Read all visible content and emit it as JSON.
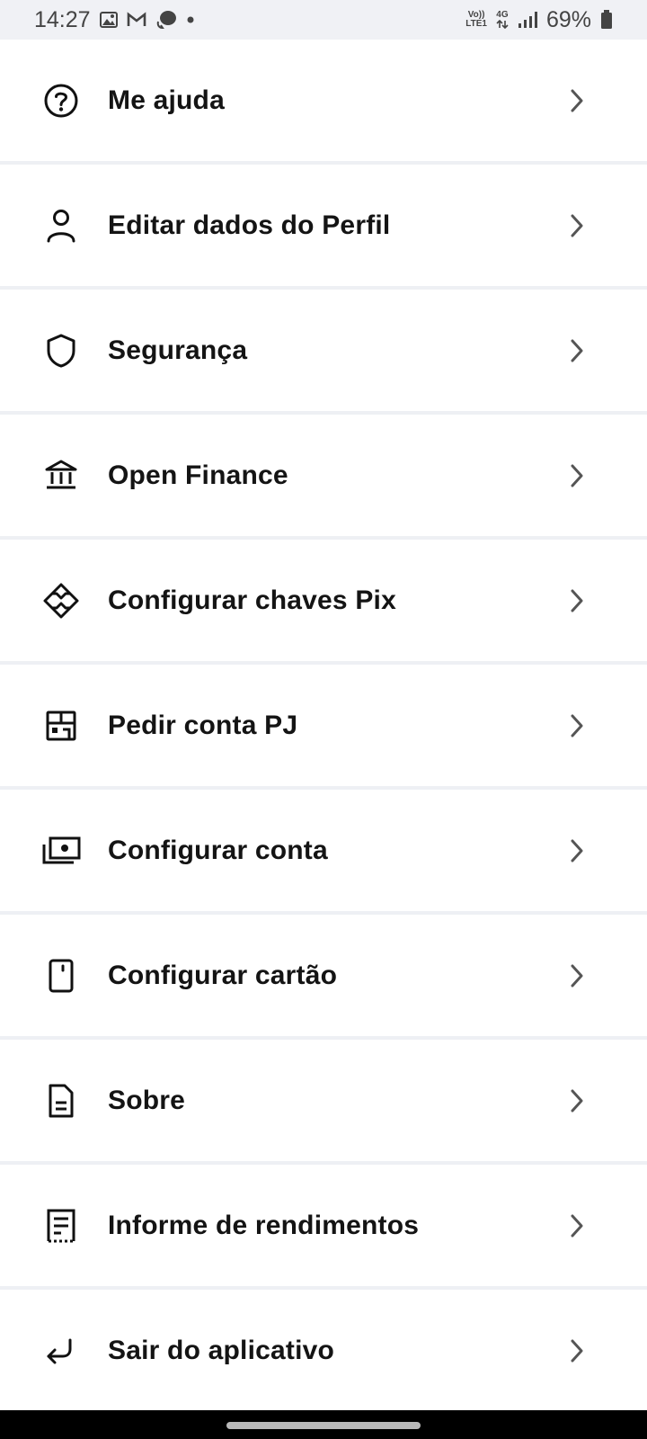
{
  "status_bar": {
    "time": "14:27",
    "network_top": "Vo))",
    "network_bottom": "LTE1",
    "data_type": "4G",
    "battery": "69%"
  },
  "menu": {
    "items": [
      {
        "label": "Me ajuda",
        "icon": "help-circle-icon"
      },
      {
        "label": "Editar dados do Perfil",
        "icon": "user-icon"
      },
      {
        "label": "Segurança",
        "icon": "shield-icon"
      },
      {
        "label": "Open Finance",
        "icon": "bank-icon"
      },
      {
        "label": "Configurar chaves Pix",
        "icon": "pix-icon"
      },
      {
        "label": "Pedir conta PJ",
        "icon": "store-icon"
      },
      {
        "label": "Configurar conta",
        "icon": "money-icon"
      },
      {
        "label": "Configurar cartão",
        "icon": "card-icon"
      },
      {
        "label": "Sobre",
        "icon": "document-icon"
      },
      {
        "label": "Informe de rendimentos",
        "icon": "receipt-icon"
      },
      {
        "label": "Sair do aplicativo",
        "icon": "logout-icon"
      }
    ]
  },
  "colors": {
    "background": "#f0f1f5",
    "item_background": "#ffffff",
    "text": "#141414",
    "chevron": "#555555"
  }
}
